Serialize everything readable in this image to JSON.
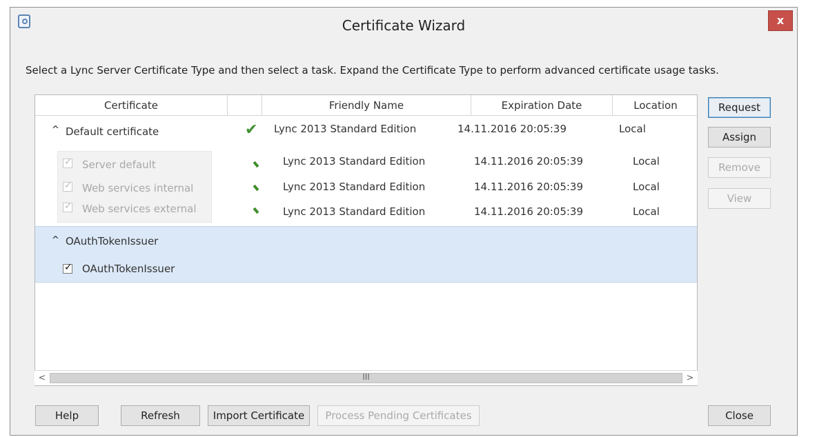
{
  "window": {
    "title": "Certificate Wizard",
    "close_glyph": "x",
    "icon": "certificate-wizard-icon"
  },
  "instructions": "Select a Lync Server Certificate Type and then select a task. Expand the Certificate Type to perform advanced certificate usage tasks.",
  "table": {
    "headers": {
      "certificate": "Certificate",
      "status": "",
      "friendly_name": "Friendly Name",
      "expiration_date": "Expiration Date",
      "location": "Location"
    },
    "groups": [
      {
        "expand_glyph": "^",
        "name": "Default certificate",
        "status": "green-check-icon",
        "friendly_name": "Lync 2013 Standard Edition",
        "expiration_date": "14.11.2016 20:05:39",
        "location": "Local",
        "items": [
          {
            "label": "Server default",
            "checked": true,
            "friendly_name": "Lync 2013 Standard Edition",
            "expiration_date": "14.11.2016 20:05:39",
            "location": "Local"
          },
          {
            "label": "Web services internal",
            "checked": true,
            "friendly_name": "Lync 2013 Standard Edition",
            "expiration_date": "14.11.2016 20:05:39",
            "location": "Local"
          },
          {
            "label": "Web services external",
            "checked": true,
            "friendly_name": "Lync 2013 Standard Edition",
            "expiration_date": "14.11.2016 20:05:39",
            "location": "Local"
          }
        ]
      },
      {
        "expand_glyph": "^",
        "name": "OAuthTokenIssuer",
        "items": [
          {
            "label": "OAuthTokenIssuer",
            "checked": true
          }
        ]
      }
    ],
    "scrollbar": {
      "left_arrow": "<",
      "right_arrow": ">",
      "grip": "III"
    }
  },
  "side_buttons": {
    "request": "Request",
    "assign": "Assign",
    "remove": "Remove",
    "view": "View"
  },
  "bottom_buttons": {
    "help": "Help",
    "refresh": "Refresh",
    "import_certificate": "Import Certificate",
    "process_pending": "Process Pending Certificates",
    "close": "Close"
  },
  "colors": {
    "selection_band": "#dbe8f7",
    "check_green": "#3f8f2e",
    "close_red": "#c7504a",
    "primary_border": "#3c7fb1"
  }
}
